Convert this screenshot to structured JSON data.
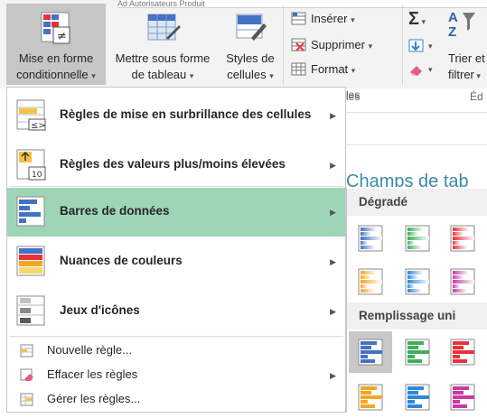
{
  "ribbon": {
    "behind_text": "Ad    Autorisateurs  Produit",
    "conditional_formatting": {
      "line1": "Mise en forme",
      "line2": "conditionnelle"
    },
    "format_as_table": {
      "line1": "Mettre sous forme",
      "line2": "de tableau"
    },
    "cell_styles": {
      "line1": "Styles de",
      "line2": "cellules"
    },
    "insert": "Insérer",
    "delete": "Supprimer",
    "format": "Format",
    "cells_group_partial": "les",
    "sort_filter": {
      "line1": "Trier et",
      "line2": "filtrer"
    },
    "editing_group_partial": "Éd"
  },
  "menu": {
    "items": [
      {
        "label": "Règles de mise en surbrillance des cellules",
        "icon": "highlight-rules-icon",
        "has_submenu": true
      },
      {
        "label": "Règles des valeurs plus/moins élevées",
        "icon": "top-bottom-rules-icon",
        "has_submenu": true
      },
      {
        "label": "Barres de données",
        "icon": "data-bars-icon",
        "has_submenu": true,
        "active": true
      },
      {
        "label": "Nuances de couleurs",
        "icon": "color-scales-icon",
        "has_submenu": true
      },
      {
        "label": "Jeux d'icônes",
        "icon": "icon-sets-icon",
        "has_submenu": true
      }
    ],
    "commands": [
      {
        "label": "Nouvelle règle...",
        "icon": "new-rule-icon"
      },
      {
        "label": "Effacer les règles",
        "icon": "clear-rules-icon",
        "has_submenu": true
      },
      {
        "label": "Gérer les règles...",
        "icon": "manage-rules-icon"
      }
    ]
  },
  "background_text": "Champs de tab",
  "submenu": {
    "gradient_title": "Dégradé",
    "solid_title": "Remplissage uni",
    "colors": [
      "#4472c4",
      "#3fae5c",
      "#e8323a",
      "#f5a623",
      "#2e86de",
      "#c93aa6"
    ]
  }
}
